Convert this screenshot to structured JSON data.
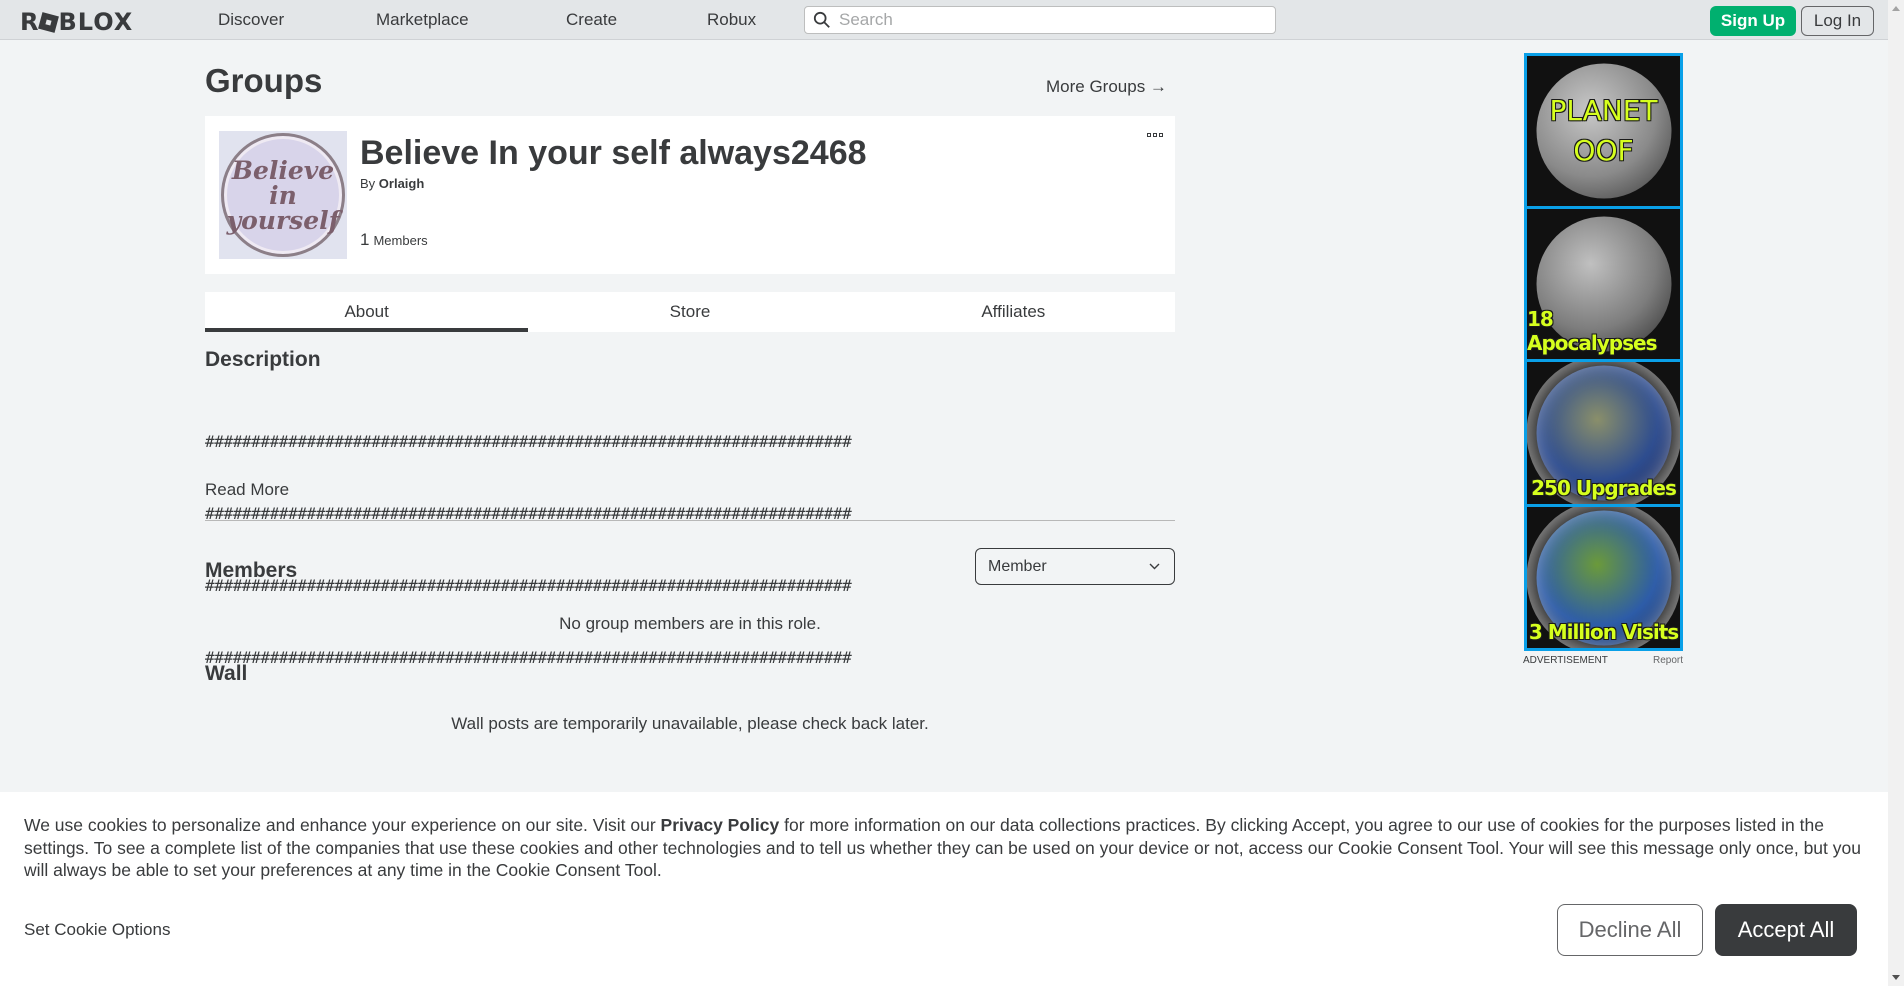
{
  "nav": {
    "logo_pre": "R",
    "logo_post": "BLOX",
    "links": [
      "Discover",
      "Marketplace",
      "Create",
      "Robux"
    ],
    "search_placeholder": "Search",
    "signup": "Sign Up",
    "login": "Log In"
  },
  "page": {
    "title": "Groups",
    "more_groups": "More Groups →"
  },
  "group": {
    "name": "Believe In your self always2468",
    "by_prefix": "By",
    "owner": "Orlaigh",
    "member_count": "1",
    "members_label": "Members",
    "thumb_line1": "Believe",
    "thumb_line2": "in",
    "thumb_line3": "yourself"
  },
  "tabs": [
    "About",
    "Store",
    "Affiliates"
  ],
  "about": {
    "description_title": "Description",
    "description_lines": [
      "######################################################################",
      "######################################################################",
      "######################################################################",
      "######################################################################"
    ],
    "read_more": "Read More",
    "members_title": "Members",
    "role_selected": "Member",
    "no_members": "No group members are in this role.",
    "wall_title": "Wall",
    "wall_msg": "Wall posts are temporarily unavailable, please check back later."
  },
  "ad": {
    "panels": [
      "PLANET OOF",
      "18 Apocalypses",
      "250 Upgrades",
      "3 Million Visits"
    ],
    "panel1_line1": "PLANET",
    "panel1_line2": "OOF",
    "caption": "ADVERTISEMENT",
    "report": "Report"
  },
  "cookie": {
    "text_before": "We use cookies to personalize and enhance your experience on our site. Visit our ",
    "link": "Privacy Policy",
    "text_after": " for more information on our data collections practices. By clicking Accept, you agree to our use of cookies for the purposes listed in the settings. To see a complete list of the companies that use these cookies and other technologies and to tell us whether they can be used on your device or not, access our Cookie Consent Tool. Your will see this message only once, but you will always be able to set your preferences at any time in the Cookie Consent Tool.",
    "set_options": "Set Cookie Options",
    "decline": "Decline All",
    "accept": "Accept All"
  }
}
